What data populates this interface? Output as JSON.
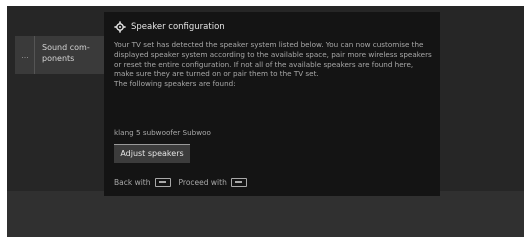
{
  "sidebar": {
    "stub_label": "...",
    "item_label": "Sound com-\nponents"
  },
  "dialog": {
    "title": "Speaker configuration",
    "body_paragraph": "Your TV set has detected the speaker system listed below. You can now customise the displayed speaker system according to the available space, pair more wireless speakers or reset the entire configuration. If not all of the available speakers are found here, make sure they are turned on or pair them to the TV set.",
    "found_heading": "The following speakers are found:",
    "found_item": "klang 5 subwoofer Subwoo",
    "adjust_button": "Adjust speakers",
    "footer_back": "Back with",
    "footer_proceed": "Proceed with"
  },
  "icons": {
    "title_icon": "gear-icon",
    "back_key": "key-icon",
    "proceed_key": "key-icon"
  }
}
